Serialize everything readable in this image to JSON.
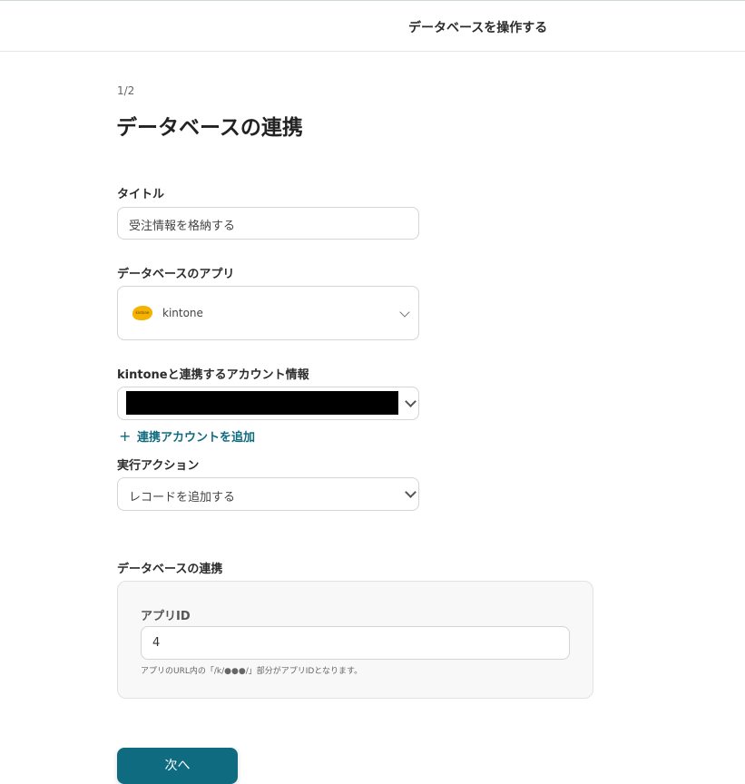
{
  "header": {
    "title": "データベースを操作する"
  },
  "step": "1/2",
  "page_title": "データベースの連携",
  "title_field": {
    "label": "タイトル",
    "value": "受注情報を格納する"
  },
  "app_field": {
    "label": "データベースのアプリ",
    "selected": "kintone",
    "logo_text": "kintone"
  },
  "account_field": {
    "label": "kintoneと連携するアカウント情報",
    "value": ""
  },
  "add_account": {
    "plus": "+",
    "label": "連携アカウントを追加"
  },
  "action_field": {
    "label": "実行アクション",
    "selected": "レコードを追加する"
  },
  "db_section": {
    "label": "データベースの連携",
    "app_id": {
      "label": "アプリID",
      "value": "4",
      "hint": "アプリのURL内の「/k/●●●/」部分がアプリIDとなります。"
    }
  },
  "next_button": {
    "label": "次へ"
  },
  "colors": {
    "accent": "#0f6b7f",
    "text": "#2b2b2b",
    "border": "#d4d4d4",
    "kintone": "#f5b301"
  }
}
